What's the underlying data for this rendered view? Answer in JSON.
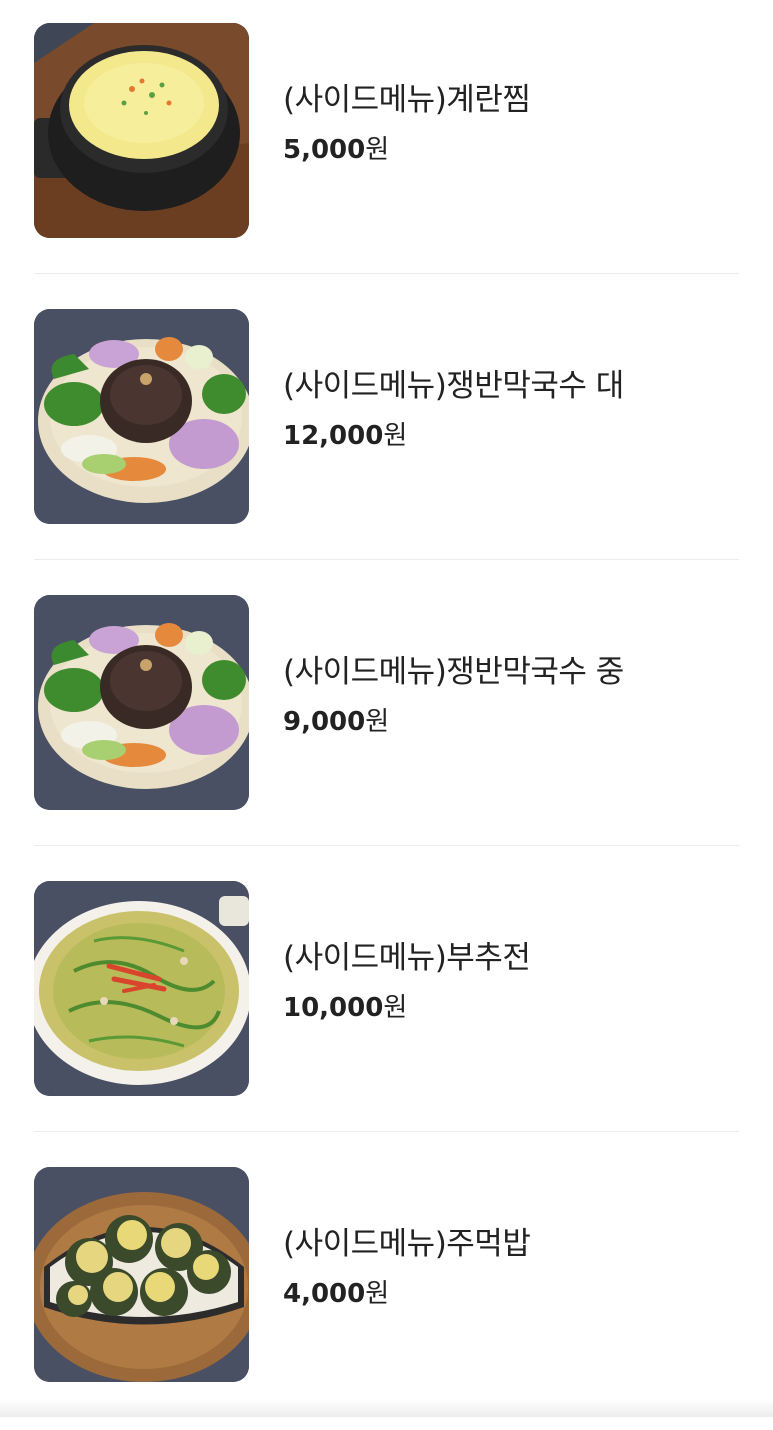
{
  "menu": {
    "items": [
      {
        "name": "(사이드메뉴)계란찜",
        "price": "5,000",
        "currency": "원",
        "image": "steamed-egg-image"
      },
      {
        "name": "(사이드메뉴)쟁반막국수 대",
        "price": "12,000",
        "currency": "원",
        "image": "tray-buckwheat-noodles-image"
      },
      {
        "name": "(사이드메뉴)쟁반막국수 중",
        "price": "9,000",
        "currency": "원",
        "image": "tray-buckwheat-noodles-image"
      },
      {
        "name": "(사이드메뉴)부추전",
        "price": "10,000",
        "currency": "원",
        "image": "chive-pancake-image"
      },
      {
        "name": "(사이드메뉴)주먹밥",
        "price": "4,000",
        "currency": "원",
        "image": "rice-ball-image"
      }
    ]
  },
  "colors": {
    "text": "#222222",
    "divider": "#ececec",
    "photo_backdrop": "#4a5064"
  }
}
